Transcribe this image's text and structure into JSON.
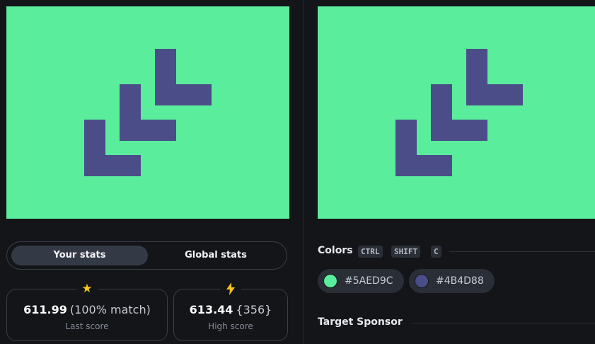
{
  "stats_toggle": {
    "your_label": "Your stats",
    "global_label": "Global stats"
  },
  "stats": {
    "last": {
      "value": "611.99",
      "extra": "(100% match)",
      "label": "Last score",
      "icon": "star-icon"
    },
    "high": {
      "value": "613.44",
      "extra": "{356}",
      "label": "High score",
      "icon": "lightning-icon"
    }
  },
  "colors_section": {
    "title": "Colors",
    "shortcut_keys": [
      "CTRL",
      "SHIFT",
      "C"
    ],
    "swatches": [
      {
        "hex": "#5AED9C",
        "label": "#5AED9C"
      },
      {
        "hex": "#4B4D88",
        "label": "#4B4D88"
      }
    ]
  },
  "sponsor_section": {
    "title": "Target Sponsor"
  },
  "palette": {
    "background": "#5AED9C",
    "shape": "#4B4D88",
    "page": "#131519",
    "accent": "#F5C518"
  }
}
